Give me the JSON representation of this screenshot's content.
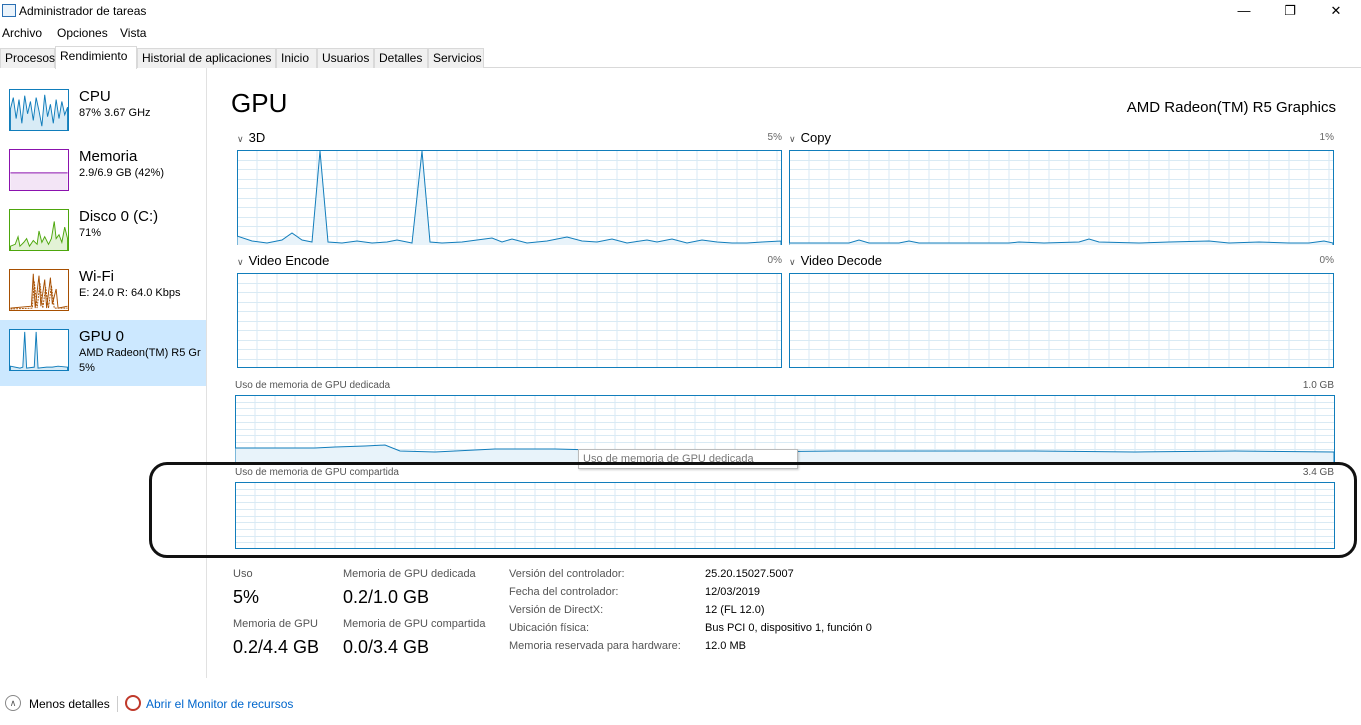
{
  "window": {
    "title": "Administrador de tareas",
    "minimize_icon": "minimize-icon",
    "maximize_icon": "restore-icon",
    "close_icon": "close-icon"
  },
  "menu": {
    "archivo": "Archivo",
    "opciones": "Opciones",
    "vista": "Vista"
  },
  "tabs": [
    "Procesos",
    "Rendimiento",
    "Historial de aplicaciones",
    "Inicio",
    "Usuarios",
    "Detalles",
    "Servicios"
  ],
  "sidebar": {
    "items": [
      {
        "title": "CPU",
        "sub": "87%  3.67 GHz",
        "sub2": "",
        "color": "#117dbb"
      },
      {
        "title": "Memoria",
        "sub": "2.9/6.9 GB (42%)",
        "sub2": "",
        "color": "#8b12ae"
      },
      {
        "title": "Disco 0 (C:)",
        "sub": "71%",
        "sub2": "",
        "color": "#4da60c"
      },
      {
        "title": "Wi-Fi",
        "sub": "E: 24.0  R: 64.0 Kbps",
        "sub2": "",
        "color": "#a74f01"
      },
      {
        "title": "GPU 0",
        "sub": "AMD Radeon(TM) R5 Gr",
        "sub2": "5%",
        "color": "#117dbb"
      }
    ]
  },
  "main": {
    "title": "GPU",
    "gpu_name": "AMD Radeon(TM) R5 Graphics",
    "graphs": {
      "g3d": {
        "label": "3D",
        "pct": "5%"
      },
      "copy": {
        "label": "Copy",
        "pct": "1%"
      },
      "encode": {
        "label": "Video Encode",
        "pct": "0%"
      },
      "decode": {
        "label": "Video Decode",
        "pct": "0%"
      }
    },
    "dedicated_label": "Uso de memoria de GPU dedicada",
    "dedicated_max": "1.0 GB",
    "shared_label": "Uso de memoria de GPU compartida",
    "shared_max": "3.4 GB",
    "tooltip": "Uso de memoria de GPU dedicada"
  },
  "stats": {
    "uso_label": "Uso",
    "uso_value": "5%",
    "ded_label": "Memoria de GPU dedicada",
    "ded_value": "0.2/1.0 GB",
    "gpu_mem_label": "Memoria de GPU",
    "gpu_mem_value": "0.2/4.4 GB",
    "shared_label": "Memoria de GPU compartida",
    "shared_value": "0.0/3.4 GB"
  },
  "info": [
    {
      "key": "Versión del controlador:",
      "value": "25.20.15027.5007"
    },
    {
      "key": "Fecha del controlador:",
      "value": "12/03/2019"
    },
    {
      "key": "Versión de DirectX:",
      "value": "12 (FL 12.0)"
    },
    {
      "key": "Ubicación física:",
      "value": "Bus PCI 0, dispositivo 1, función 0"
    },
    {
      "key": "Memoria reservada para hardware:",
      "value": "12.0 MB"
    }
  ],
  "footer": {
    "less_details": "Menos detalles",
    "monitor": "Abrir el Monitor de recursos"
  },
  "colors": {
    "gpu_line": "#117dbb",
    "grid": "#d9eaf4",
    "selected_bg": "#cce8ff",
    "link": "#0066cc"
  }
}
